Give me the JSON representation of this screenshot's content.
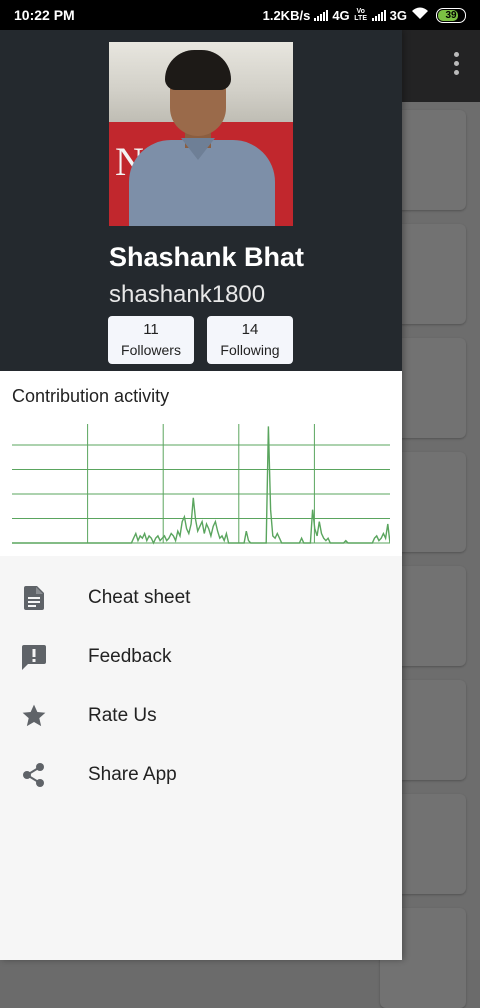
{
  "status_bar": {
    "time": "10:22 PM",
    "network_speed": "1.2KB/s",
    "network_type_1": "4G",
    "volte": "Vo LTE",
    "network_type_2": "3G",
    "battery": "39",
    "icons": [
      "signal-icon",
      "signal-icon",
      "wifi-icon",
      "battery-icon"
    ]
  },
  "profile": {
    "name": "Shashank Bhat",
    "username": "shashank1800",
    "photo_banner_text": "NI",
    "stats": [
      {
        "value": "11",
        "label": "Followers"
      },
      {
        "value": "14",
        "label": "Following"
      }
    ]
  },
  "activity": {
    "title": "Contribution activity"
  },
  "menu": [
    {
      "label": "Cheat sheet",
      "icon": "document-icon"
    },
    {
      "label": "Feedback",
      "icon": "feedback-icon"
    },
    {
      "label": "Rate Us",
      "icon": "star-icon"
    },
    {
      "label": "Share App",
      "icon": "share-icon"
    }
  ],
  "colors": {
    "header_bg": "#24292e",
    "chart_line": "#5aa55e",
    "drawer_bg": "#f6f6f6"
  },
  "chart_data": {
    "type": "line",
    "title": "Contribution activity",
    "xlabel": "",
    "ylabel": "",
    "grid": true,
    "ylim": [
      0,
      5
    ],
    "values": [
      0,
      0,
      0,
      0,
      0,
      0,
      0,
      0,
      0,
      0,
      0,
      0,
      0,
      0,
      0,
      0,
      0,
      0,
      0,
      0,
      0,
      0,
      0,
      0,
      0,
      0,
      0,
      0,
      0,
      0,
      0,
      0,
      0,
      0,
      0,
      0,
      0,
      0,
      0,
      0,
      0,
      0,
      0,
      0,
      0,
      0,
      0,
      0,
      0,
      0,
      0,
      0,
      0,
      0,
      0,
      0.2,
      0.4,
      0.1,
      0.3,
      0.2,
      0.4,
      0.1,
      0.3,
      0.2,
      0,
      0.2,
      0.3,
      0.1,
      0.2,
      0.3,
      0.1,
      0.2,
      0.4,
      0.3,
      0.1,
      0.5,
      0.3,
      0.9,
      1.1,
      0.6,
      0.4,
      0.8,
      1.9,
      1.0,
      0.5,
      0.7,
      0.9,
      0.4,
      0.8,
      0.6,
      0.3,
      0.7,
      0.9,
      0.5,
      0.2,
      0.3,
      0.1,
      0.4,
      0,
      0,
      0,
      0,
      0,
      0,
      0,
      0,
      0.5,
      0.1,
      0,
      0,
      0,
      0,
      0,
      0,
      0,
      0,
      4.9,
      1.4,
      0.3,
      0.2,
      0.4,
      0.2,
      0,
      0,
      0,
      0,
      0,
      0,
      0,
      0,
      0,
      0.2,
      0,
      0,
      0,
      0,
      1.4,
      0.6,
      0.3,
      0.9,
      0.4,
      0.2,
      0.1,
      0.2,
      0,
      0,
      0,
      0,
      0,
      0,
      0,
      0.1,
      0,
      0,
      0,
      0,
      0,
      0,
      0,
      0,
      0,
      0,
      0,
      0,
      0.2,
      0.3,
      0.1,
      0.2,
      0.4,
      0.2,
      0.8,
      0
    ]
  }
}
